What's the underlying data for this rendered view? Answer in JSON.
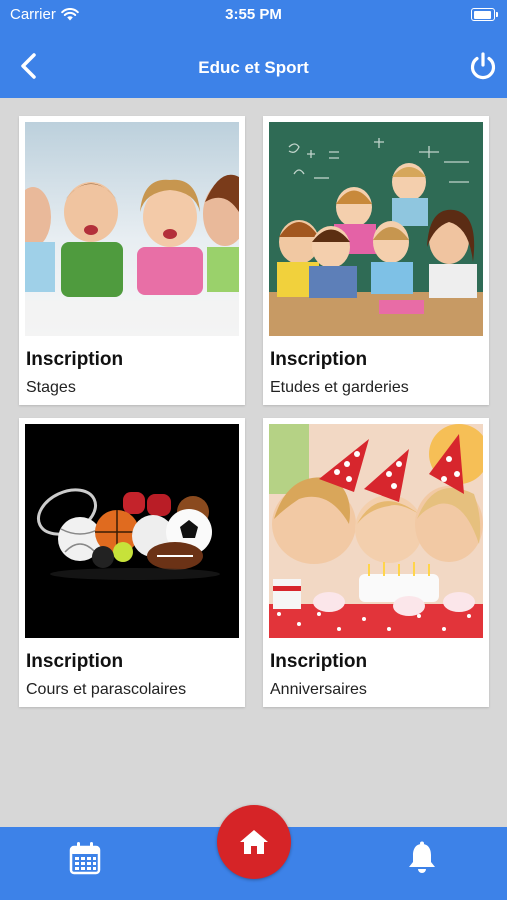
{
  "status_bar": {
    "carrier": "Carrier",
    "time": "3:55 PM"
  },
  "nav": {
    "title": "Educ et Sport",
    "back_icon": "chevron-left-icon",
    "power_icon": "power-icon"
  },
  "cards": [
    {
      "heading": "Inscription",
      "subtitle": "Stages",
      "image": "kids-lying-smiling-photo"
    },
    {
      "heading": "Inscription",
      "subtitle": "Etudes et garderies",
      "image": "classroom-kids-teacher-photo"
    },
    {
      "heading": "Inscription",
      "subtitle": "Cours et parascolaires",
      "image": "sports-balls-photo"
    },
    {
      "heading": "Inscription",
      "subtitle": "Anniversaires",
      "image": "birthday-party-cake-photo"
    }
  ],
  "tab_bar": {
    "left_icon": "calendar-icon",
    "center_icon": "home-icon",
    "right_icon": "bell-icon"
  },
  "colors": {
    "primary": "#3d82e8",
    "home_button": "#d62427",
    "background": "#d7d7d7"
  }
}
